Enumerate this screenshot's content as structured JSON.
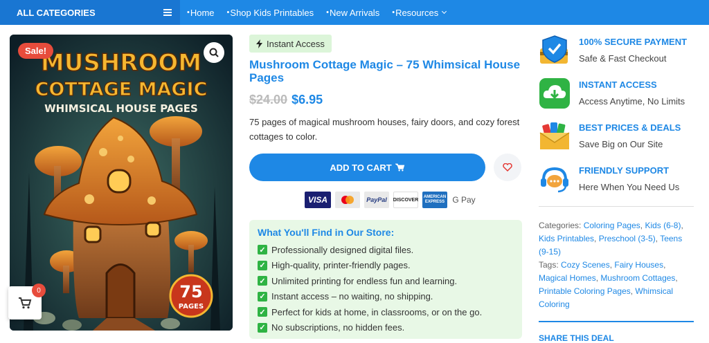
{
  "nav": {
    "all_categories": "ALL CATEGORIES",
    "links": [
      "Home",
      "Shop Kids Printables",
      "New Arrivals",
      "Resources"
    ]
  },
  "product": {
    "sale_badge": "Sale!",
    "cover_title_1": "MUSHROOM",
    "cover_title_2": "COTTAGE MAGIC",
    "cover_subtitle": "WHIMSICAL HOUSE PAGES",
    "cover_pages_number": "75",
    "cover_pages_label": "PAGES",
    "access_badge": "Instant Access",
    "title": "Mushroom Cottage Magic – 75 Whimsical House Pages",
    "old_price": "$24.00",
    "new_price": "$6.95",
    "description": "75 pages of magical mushroom houses, fairy doors, and cozy forest cottages to color.",
    "add_to_cart": "ADD TO CART",
    "cart_count": "0"
  },
  "payments": {
    "visa": "VISA",
    "paypal": "PayPal",
    "discover": "DISCOVER",
    "amex": "AMERICAN EXPRESS",
    "gpay": "G Pay"
  },
  "store": {
    "heading": "What You'll Find in Our Store:",
    "items": [
      "Professionally designed digital files.",
      "High-quality, printer-friendly pages.",
      "Unlimited printing for endless fun and learning.",
      "Instant access – no waiting, no shipping.",
      "Perfect for kids at home, in classrooms, or on the go.",
      "No subscriptions, no hidden fees."
    ]
  },
  "features": [
    {
      "title": "100% SECURE PAYMENT",
      "subtitle": "Safe & Fast Checkout",
      "icon": "shield-card-icon"
    },
    {
      "title": "INSTANT ACCESS",
      "subtitle": "Access Anytime, No Limits",
      "icon": "cloud-download-icon"
    },
    {
      "title": "BEST PRICES & DEALS",
      "subtitle": "Save Big on Our Site",
      "icon": "coupons-icon"
    },
    {
      "title": "FRIENDLY SUPPORT",
      "subtitle": "Here When You Need Us",
      "icon": "headset-chat-icon"
    }
  ],
  "meta": {
    "categories_label": "Categories:",
    "categories": [
      "Coloring Pages",
      "Kids (6-8)",
      "Kids Printables",
      "Preschool (3-5)",
      "Teens (9-15)"
    ],
    "tags_label": "Tags:",
    "tags": [
      "Cozy Scenes",
      "Fairy Houses",
      "Magical Homes",
      "Mushroom Cottages",
      "Printable Coloring Pages",
      "Whimsical Coloring"
    ],
    "share": "SHARE THIS DEAL"
  },
  "colors": {
    "brand_blue": "#1e88e5",
    "sale_red": "#e74c3c",
    "success_green": "#2fb344"
  }
}
